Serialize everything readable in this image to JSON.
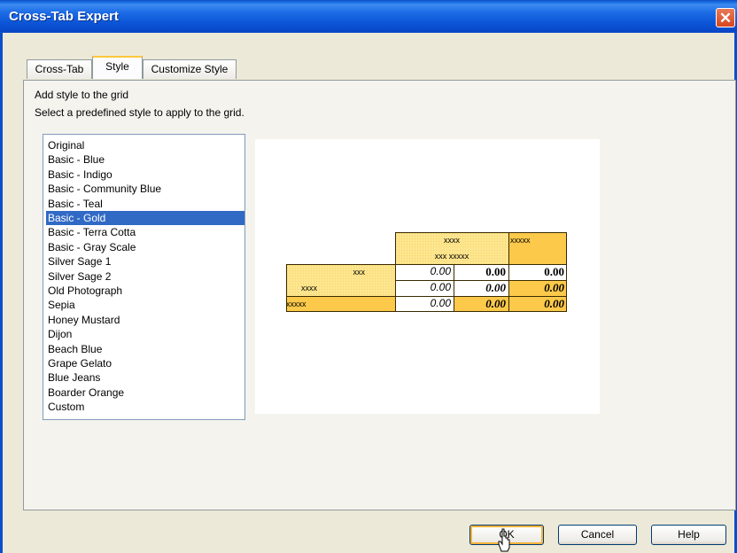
{
  "window": {
    "title": "Cross-Tab Expert",
    "close_glyph": "✕"
  },
  "tabs": [
    {
      "label": "Cross-Tab",
      "active": false
    },
    {
      "label": "Style",
      "active": true
    },
    {
      "label": "Customize Style",
      "active": false
    }
  ],
  "content": {
    "heading": "Add style to the grid",
    "instruction": "Select a predefined style to apply to the grid."
  },
  "styles_list": {
    "selected": "Basic - Gold",
    "items": [
      "Original",
      "Basic - Blue",
      "Basic - Indigo",
      "Basic - Community Blue",
      "Basic - Teal",
      "Basic - Gold",
      "Basic - Terra Cotta",
      "Basic - Gray Scale",
      "Silver Sage 1",
      "Silver Sage 2",
      "Old Photograph",
      "Sepia",
      "Honey Mustard",
      "Dijon",
      "Beach Blue",
      "Grape Gelato",
      "Blue Jeans",
      "Boarder Orange",
      "Custom"
    ]
  },
  "preview": {
    "col_header_1": "xxxx",
    "col_header_2": "xxxxx",
    "col_subheader": "xxx xxxxx",
    "row_labels": [
      "xxx",
      "xxxx",
      "xxxxx"
    ],
    "cells": [
      [
        "0.00",
        "0.00",
        "0.00"
      ],
      [
        "0.00",
        "0.00",
        "0.00"
      ],
      [
        "0.00",
        "0.00",
        "0.00"
      ]
    ],
    "colors": {
      "gold": "#FCC94A",
      "gold_light": "#FDE68F"
    }
  },
  "buttons": {
    "ok": "OK",
    "cancel": "Cancel",
    "help": "Help"
  },
  "colors": {
    "titlebar": "#0A5FD8",
    "selection": "#316AC5",
    "dialog_bg": "#ECE9D8"
  }
}
